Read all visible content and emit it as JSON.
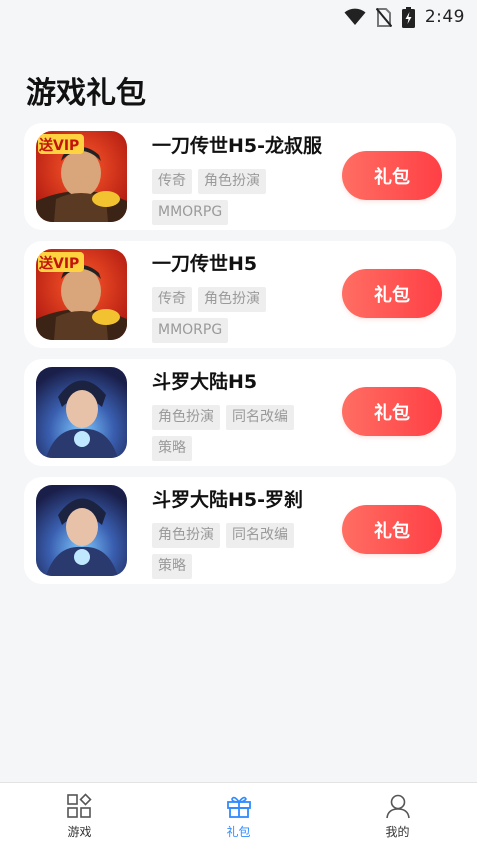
{
  "status_bar": {
    "time": "2:49"
  },
  "page": {
    "title": "游戏礼包"
  },
  "games": [
    {
      "name": "一刀传世H5-龙叔服",
      "tags": [
        "传奇",
        "角色扮演",
        "MMORPG"
      ],
      "button_label": "礼包",
      "icon": "vip-warrior-icon",
      "icon_badge": "送VIP"
    },
    {
      "name": "一刀传世H5",
      "tags": [
        "传奇",
        "角色扮演",
        "MMORPG"
      ],
      "button_label": "礼包",
      "icon": "vip-warrior-icon",
      "icon_badge": "送VIP"
    },
    {
      "name": "斗罗大陆H5",
      "tags": [
        "角色扮演",
        "同名改编",
        "策略"
      ],
      "button_label": "礼包",
      "icon": "hero-icon"
    },
    {
      "name": "斗罗大陆H5-罗刹",
      "tags": [
        "角色扮演",
        "同名改编",
        "策略"
      ],
      "button_label": "礼包",
      "icon": "hero-icon"
    }
  ],
  "bottom_nav": {
    "items": [
      {
        "label": "游戏",
        "icon": "grid-icon",
        "active": false
      },
      {
        "label": "礼包",
        "icon": "gift-icon",
        "active": true
      },
      {
        "label": "我的",
        "icon": "user-icon",
        "active": false
      }
    ]
  },
  "colors": {
    "accent": "#ff4b4b",
    "nav_active": "#2f8bff",
    "background": "#f5f6f8",
    "tag_bg": "#eeeeee",
    "tag_text": "#9a9a9a"
  }
}
